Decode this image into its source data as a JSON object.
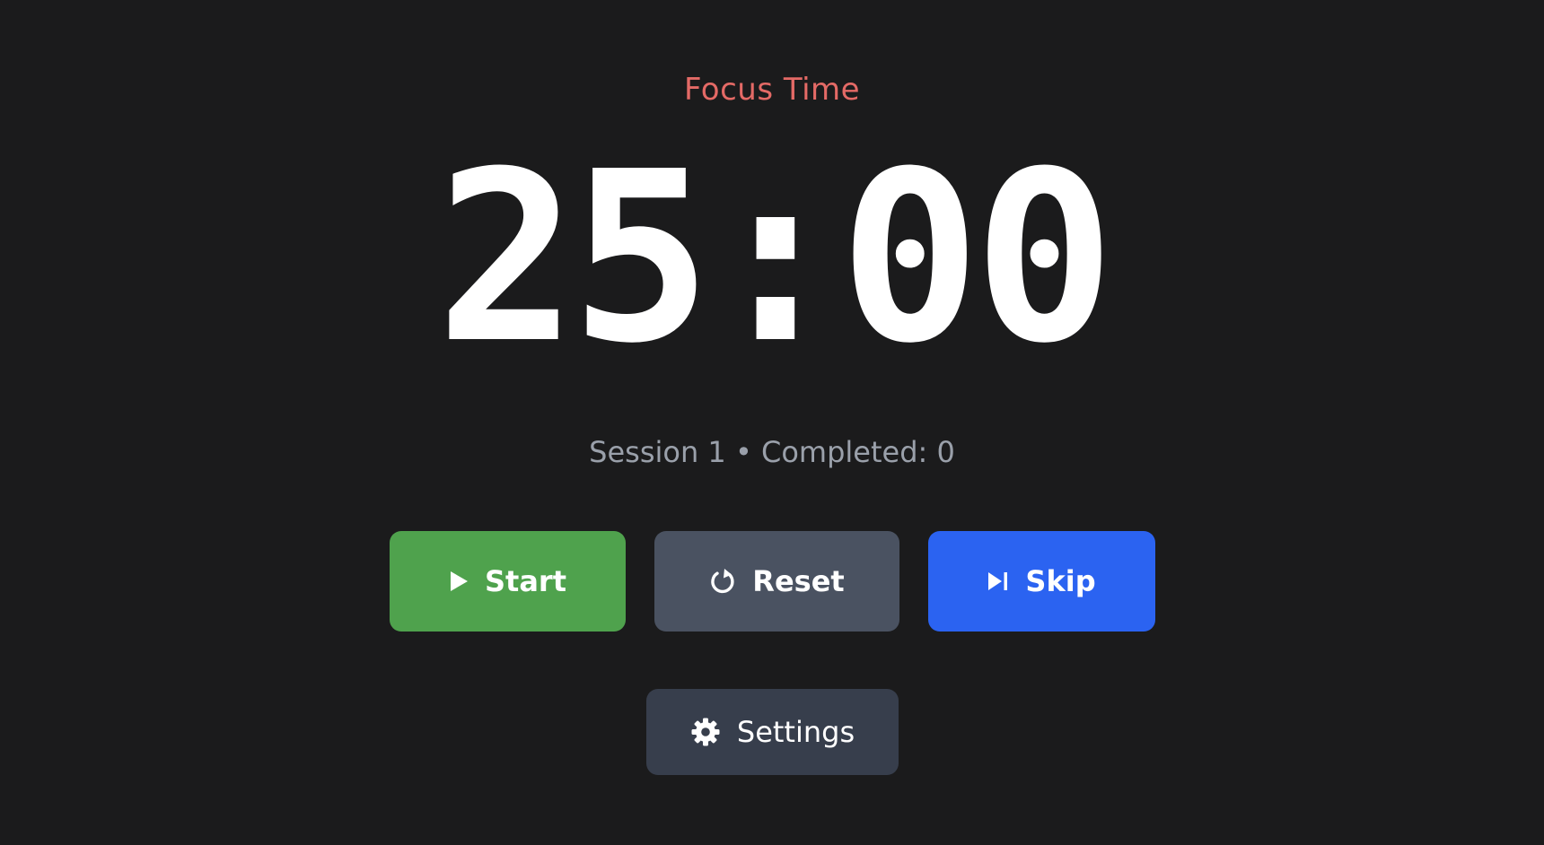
{
  "mode": {
    "label": "Focus Time",
    "color": "#e46a66"
  },
  "timer": {
    "display": "25:00"
  },
  "session": {
    "info": "Session 1 • Completed: 0"
  },
  "controls": {
    "start": {
      "label": "Start",
      "icon": "play-icon",
      "color": "#4fa24d"
    },
    "reset": {
      "label": "Reset",
      "icon": "reset-icon",
      "color": "#4a5261"
    },
    "skip": {
      "label": "Skip",
      "icon": "skip-forward-icon",
      "color": "#2b63f1"
    }
  },
  "settings": {
    "label": "Settings",
    "icon": "gear-icon",
    "color": "#373e4c"
  },
  "theme": {
    "background": "#1b1b1c",
    "text": "#ffffff",
    "muted_text": "#9aa0aa"
  }
}
